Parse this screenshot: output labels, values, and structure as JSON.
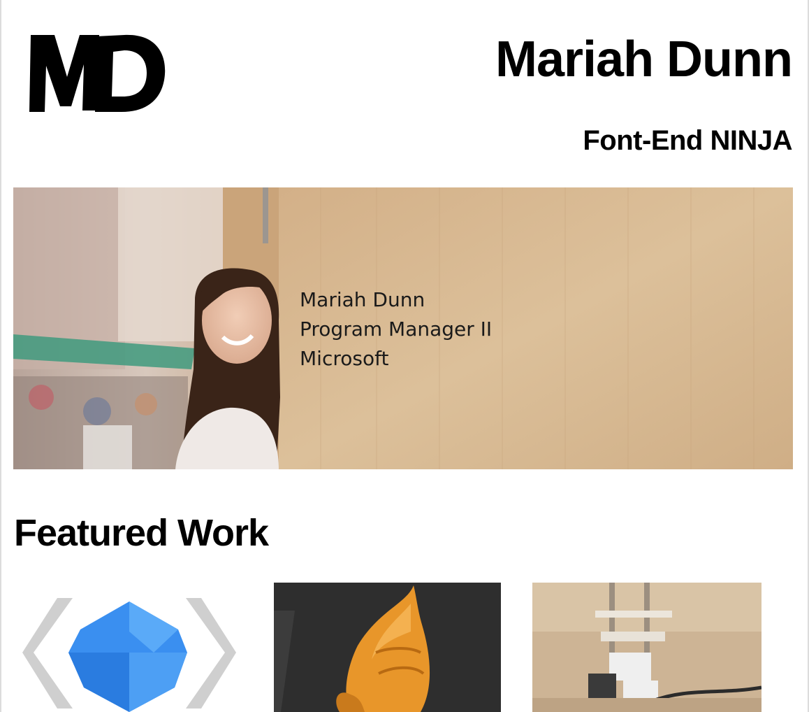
{
  "header": {
    "logo_text": "MD",
    "name": "Mariah Dunn",
    "tagline": "Font-End NINJA"
  },
  "banner": {
    "lines": [
      "Mariah Dunn",
      "Program Manager II",
      "Microsoft"
    ]
  },
  "featured": {
    "heading": "Featured Work",
    "items": [
      {
        "icon": "code-brackets-cube-icon"
      },
      {
        "icon": "hermit-crab-shell-render"
      },
      {
        "icon": "machine-rig-photo"
      }
    ]
  },
  "colors": {
    "text": "#000000",
    "banner_wood": "#d9b98f",
    "cube_blue": "#3a8ff0",
    "thumb_dark": "#2e2e2e",
    "shell_orange": "#e8962a"
  }
}
